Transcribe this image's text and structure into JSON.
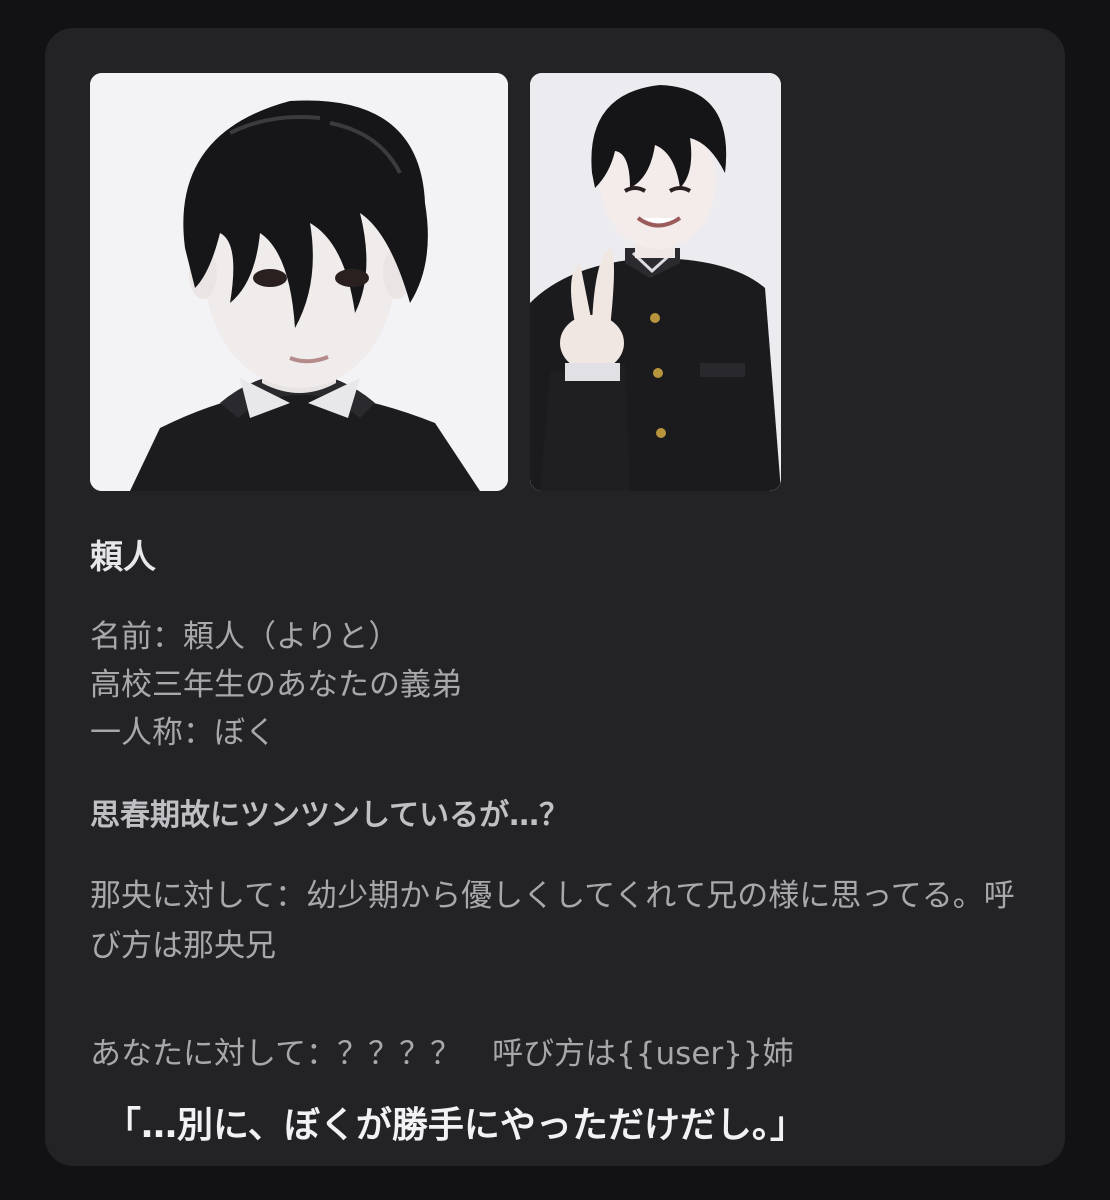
{
  "character": {
    "title": "頼人",
    "images": [
      "portrait-closeup-image",
      "peace-sign-pose-image"
    ],
    "profile_lines": [
      "名前：頼人（よりと）",
      "高校三年生のあなたの義弟",
      "一人称：ぼく"
    ],
    "tagline": "思春期故にツンツンしているが…？",
    "relation_nao": "那央に対して：幼少期から優しくしてくれて兄の様に思ってる。呼び方は那央兄",
    "relation_user": "あなたに対して：？？？？　呼び方は{{user}}姉",
    "quote": "「…別に、ぼくが勝手にやっただけだし。」"
  },
  "colors": {
    "page_background": "#121214",
    "card_background": "#232326",
    "title_text": "#e7e7e9",
    "body_text": "#a7a7ac",
    "quote_text": "#f2f2f4"
  }
}
